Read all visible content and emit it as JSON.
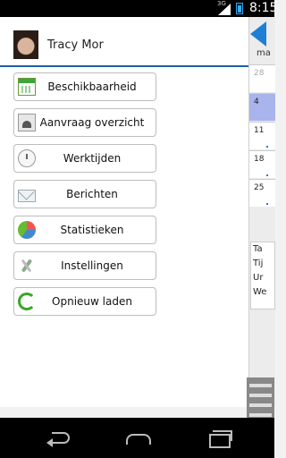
{
  "status_bar": {
    "time": "8:15",
    "network": "3G"
  },
  "profile": {
    "name": "Tracy Mor"
  },
  "menu": [
    {
      "label": "Beschikbaarheid",
      "icon": "calendar-icon"
    },
    {
      "label": "Aanvraag overzicht",
      "icon": "users-folder-icon"
    },
    {
      "label": "Werktijden",
      "icon": "clock-icon"
    },
    {
      "label": "Berichten",
      "icon": "mail-icon"
    },
    {
      "label": "Statistieken",
      "icon": "pie-chart-icon"
    },
    {
      "label": "Instellingen",
      "icon": "tools-icon"
    },
    {
      "label": "Opnieuw laden",
      "icon": "reload-icon"
    }
  ],
  "calendar_peek": {
    "day_header": "ma",
    "dates": [
      "28",
      "4",
      "11",
      "18",
      "25"
    ],
    "info_lines": [
      "Ta",
      "Tij",
      "Ur",
      "We"
    ]
  }
}
